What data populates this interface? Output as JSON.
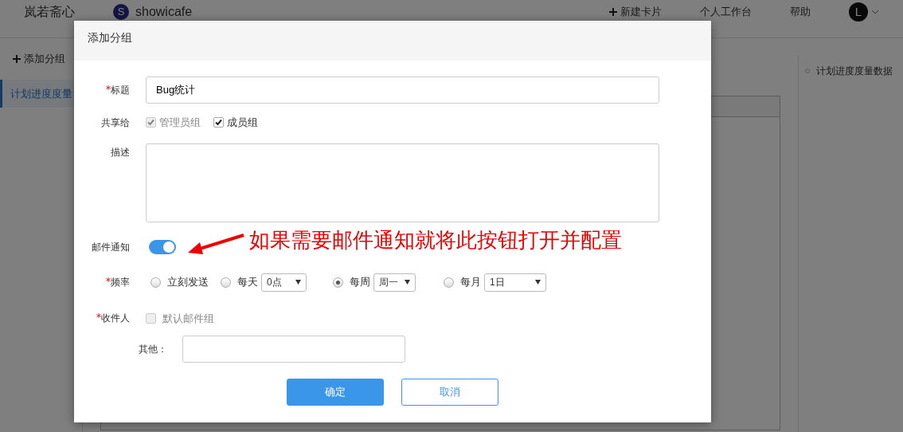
{
  "header": {
    "logo": "岚若斋心",
    "project": {
      "initial": "S",
      "name": "showicafe"
    },
    "actions": [
      {
        "kind": "add",
        "label": "新建卡片"
      },
      {
        "kind": "text",
        "label": "个人工作台"
      },
      {
        "kind": "text",
        "label": "帮助"
      }
    ],
    "avatar": "L"
  },
  "sidebar": {
    "add_label": "添加分组",
    "items": [
      {
        "label": "计划进度度量",
        "selected": true
      }
    ]
  },
  "right_panel": {
    "items": [
      "计划进度度量数据"
    ]
  },
  "dialog": {
    "title": "添加分组",
    "fields": {
      "title": {
        "label": "标题",
        "required": true,
        "value": "Bug统计"
      },
      "share": {
        "label": "共享给",
        "options": [
          {
            "label": "管理员组",
            "checked": true,
            "disabled": true
          },
          {
            "label": "成员组",
            "checked": true,
            "disabled": false
          }
        ]
      },
      "description": {
        "label": "描述"
      },
      "email_notify": {
        "label": "邮件通知",
        "on": true
      },
      "frequency": {
        "label": "频率",
        "required": true,
        "options": [
          {
            "label": "立刻发送",
            "selected": false
          },
          {
            "label": "每天",
            "selected": false,
            "select": "0点"
          },
          {
            "label": "每周",
            "selected": true,
            "select": "周一"
          },
          {
            "label": "每月",
            "selected": false,
            "select": "1日"
          }
        ]
      },
      "recipients": {
        "label": "收件人",
        "required": true,
        "default_group": {
          "label": "默认邮件组",
          "checked": false,
          "disabled": true
        },
        "other_label": "其他："
      }
    },
    "buttons": [
      {
        "kind": "primary",
        "label": "确定"
      },
      {
        "kind": "secondary",
        "label": "取消"
      }
    ],
    "annotation": "如果需要邮件通知就将此按钮打开并配置"
  }
}
